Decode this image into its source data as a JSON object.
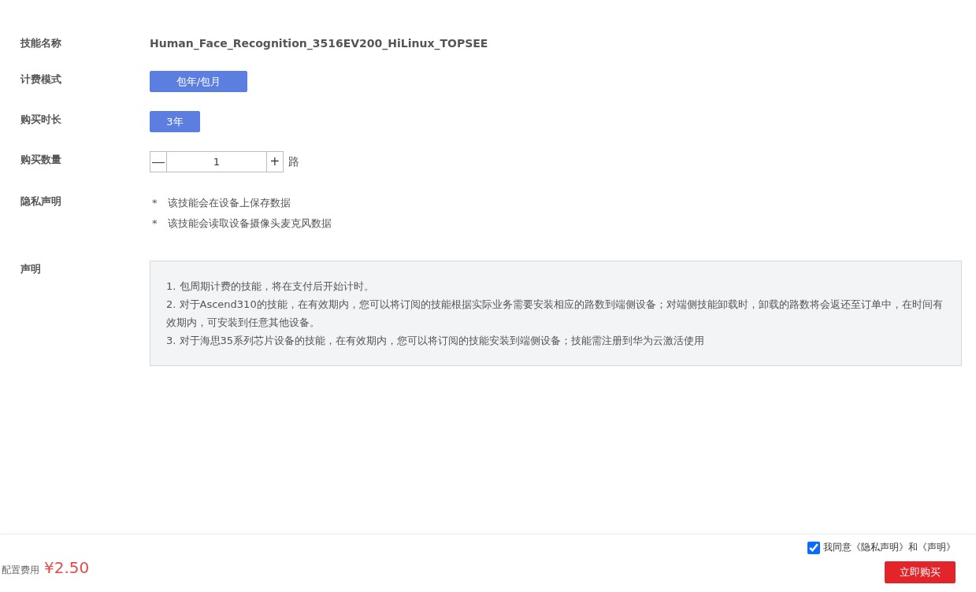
{
  "form": {
    "rows": [
      {
        "kind": "text",
        "label": "技能名称",
        "value": "Human_Face_Recognition_3516EV200_HiLinux_TOPSEE"
      },
      {
        "kind": "options",
        "label": "计费模式",
        "options": [
          {
            "label": "包年/包月",
            "selected": true
          }
        ]
      },
      {
        "kind": "options",
        "label": "购买时长",
        "options": [
          {
            "label": "3年",
            "selected": true
          }
        ]
      },
      {
        "kind": "stepper",
        "label": "购买数量",
        "minus": "—",
        "value": "1",
        "plus": "+",
        "unit": "路"
      },
      {
        "kind": "list",
        "label": "隐私声明",
        "items": [
          {
            "mark": "*",
            "text": "该技能会在设备上保存数据"
          },
          {
            "mark": "*",
            "text": "该技能会读取设备摄像头麦克风数据"
          }
        ]
      },
      {
        "kind": "notice",
        "label": "声明",
        "items": [
          "1. 包周期计费的技能，将在支付后开始计时。",
          "2. 对于Ascend310的技能，在有效期内，您可以将订阅的技能根据实际业务需要安装相应的路数到端侧设备；对端侧技能卸载时，卸载的路数将会返还至订单中，在时间有效期内，可安装到任意其他设备。",
          "3. 对于海思35系列芯片设备的技能，在有效期内，您可以将订阅的技能安装到端侧设备；技能需注册到华为云激活使用"
        ]
      }
    ]
  },
  "footer": {
    "fee_label": "配置费用",
    "price": "¥2.50",
    "agree": {
      "checked": true,
      "text": "我同意《隐私声明》和《声明》"
    },
    "buy_button": "立即购买"
  }
}
